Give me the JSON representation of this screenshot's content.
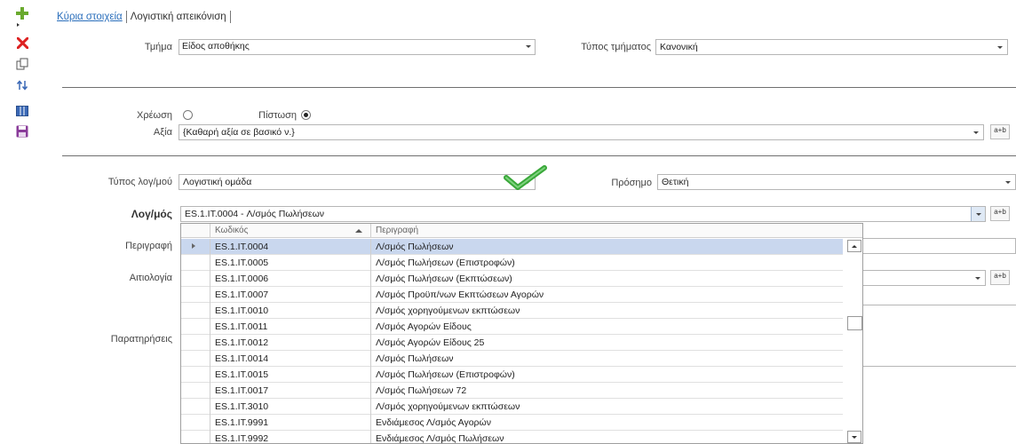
{
  "toolbar": {
    "add_icon": "plus-icon",
    "delete_icon": "x-icon",
    "copy_icon": "copy-icon",
    "sort_icon": "sort-arrows-icon",
    "columns_icon": "columns-icon",
    "save_icon": "floppy-disk-icon",
    "colors": {
      "add": "#6aaa2e",
      "delete": "#dd2222",
      "blue": "#3a68b6",
      "save": "#8a3c9a"
    }
  },
  "tabs": {
    "main": "Κύρια στοιχεία",
    "accounting": "Λογιστική απεικόνιση"
  },
  "form": {
    "department_label": "Τμήμα",
    "department_value": "Είδος αποθήκης",
    "dept_type_label": "Τύπος τμήματος",
    "dept_type_value": "Κανονική",
    "debit_label": "Χρέωση",
    "credit_label": "Πίστωση",
    "selected_side": "credit",
    "value_label": "Αξία",
    "value_value": "{Καθαρή αξία σε βασικό ν.}",
    "account_type_label": "Τύπος λογ/μού",
    "account_type_value": "Λογιστική ομάδα",
    "sign_label": "Πρόσημο",
    "sign_value": "Θετική",
    "account_label": "Λογ/μός",
    "account_value": "ES.1.IT.0004 -  Λ/σμός Πωλήσεων",
    "description_label": "Περιγραφή",
    "reason_label": "Αιτιολογία",
    "notes_label": "Παρατηρήσεις",
    "formula_button": "a+b"
  },
  "lookup": {
    "col_code": "Κωδικός",
    "col_desc": "Περιγραφή",
    "selected_index": 0,
    "rows": [
      {
        "code": "ES.1.IT.0004",
        "desc": "Λ/σμός Πωλήσεων"
      },
      {
        "code": "ES.1.IT.0005",
        "desc": "Λ/σμός Πωλήσεων (Επιστροφών)"
      },
      {
        "code": "ES.1.IT.0006",
        "desc": "Λ/σμός Πωλήσεων (Εκπτώσεων)"
      },
      {
        "code": "ES.1.IT.0007",
        "desc": "Λ/σμός Προϋπ/νων Εκπτώσεων Αγορών"
      },
      {
        "code": "ES.1.IT.0010",
        "desc": "Λ/σμός χορηγούμενων εκπτώσεων"
      },
      {
        "code": "ES.1.IT.0011",
        "desc": "Λ/σμός Αγορών Είδους"
      },
      {
        "code": "ES.1.IT.0012",
        "desc": "Λ/σμός Αγορών Είδους 25"
      },
      {
        "code": "ES.1.IT.0014",
        "desc": "Λ/σμός Πωλήσεων"
      },
      {
        "code": "ES.1.IT.0015",
        "desc": "Λ/σμός Πωλήσεων (Επιστροφών)"
      },
      {
        "code": "ES.1.IT.0017",
        "desc": "Λ/σμός Πωλήσεων 72"
      },
      {
        "code": "ES.1.IT.3010",
        "desc": "Λ/σμός χορηγούμενων εκπτώσεων"
      },
      {
        "code": "ES.1.IT.9991",
        "desc": "Ενδιάμεσος Λ/σμός Αγορών"
      },
      {
        "code": "ES.1.IT.9992",
        "desc": "Ενδιάμεσος Λ/σμός Πωλήσεων"
      }
    ]
  },
  "status": {
    "check_icon": "checkmark-icon",
    "check_color": "#3aa83a"
  }
}
